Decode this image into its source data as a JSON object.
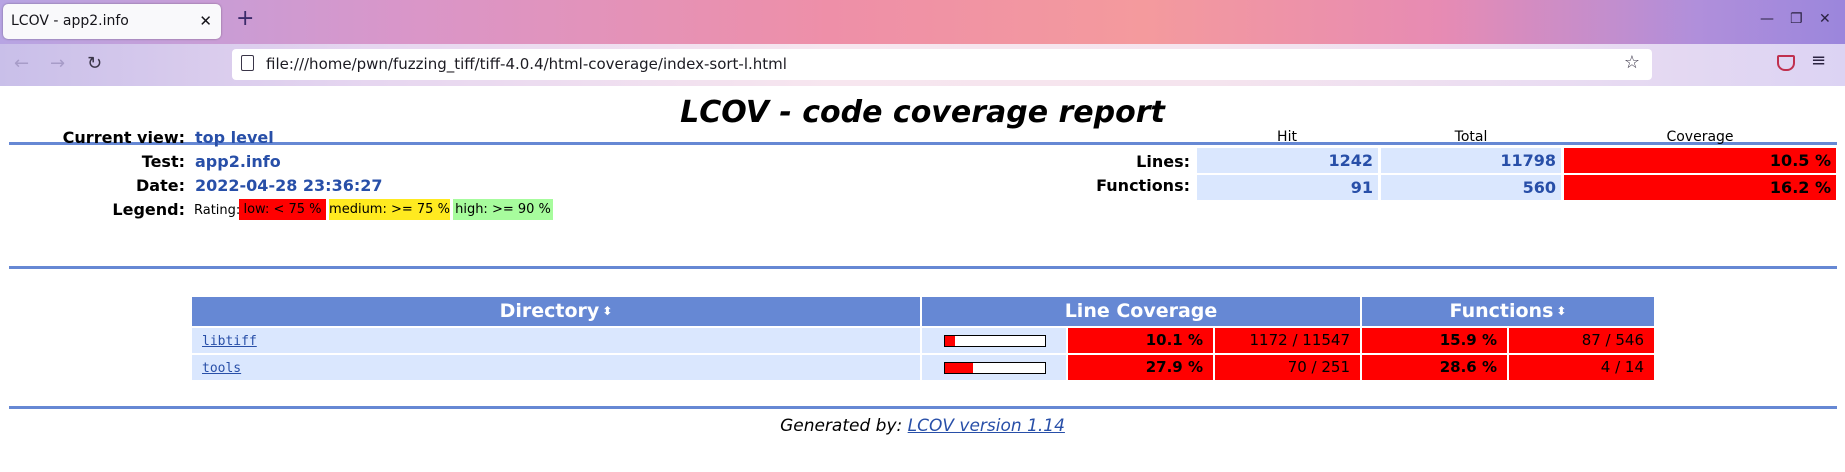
{
  "browser": {
    "tab_title": "LCOV - app2.info",
    "tab_close": "✕",
    "new_tab": "+",
    "url": "file:///home/pwn/fuzzing_tiff/tiff-4.0.4/html-coverage/index-sort-l.html",
    "icons": {
      "back": "←",
      "forward": "→",
      "reload": "↻",
      "star": "☆",
      "menu": "≡",
      "minimize": "—",
      "restore": "❐",
      "close": "✕"
    }
  },
  "report": {
    "title": "LCOV - code coverage report",
    "info": {
      "current_view_label": "Current view:",
      "current_view": "top level",
      "test_label": "Test:",
      "test": "app2.info",
      "date_label": "Date:",
      "date": "2022-04-28 23:36:27",
      "legend_label": "Legend:",
      "legend_rating": "Rating:",
      "legend": [
        {
          "label": "low: < 75 %",
          "color": "#ff0000"
        },
        {
          "label": "medium: >= 75 %",
          "color": "#ffea20"
        },
        {
          "label": "high: >= 90 %",
          "color": "#a7fc9d"
        }
      ]
    },
    "summary": {
      "headers": [
        "Hit",
        "Total",
        "Coverage"
      ],
      "rows": [
        {
          "label": "Lines:",
          "hit": "1242",
          "total": "11798",
          "coverage": "10.5 %"
        },
        {
          "label": "Functions:",
          "hit": "91",
          "total": "560",
          "coverage": "16.2 %"
        }
      ]
    },
    "table": {
      "headers": {
        "directory": "Directory",
        "line_coverage": "Line Coverage",
        "functions": "Functions",
        "sort_icon": "⬍"
      },
      "rows": [
        {
          "name": "libtiff",
          "line_pct": "10.1 %",
          "line_fraction": 0.101,
          "lines": "1172 / 11547",
          "func_pct": "15.9 %",
          "funcs": "87 / 546"
        },
        {
          "name": "tools",
          "line_pct": "27.9 %",
          "line_fraction": 0.279,
          "lines": "70 / 251",
          "func_pct": "28.6 %",
          "funcs": "4 / 14"
        }
      ]
    },
    "footer": {
      "prefix": "Generated by:",
      "link": "LCOV version 1.14"
    }
  }
}
